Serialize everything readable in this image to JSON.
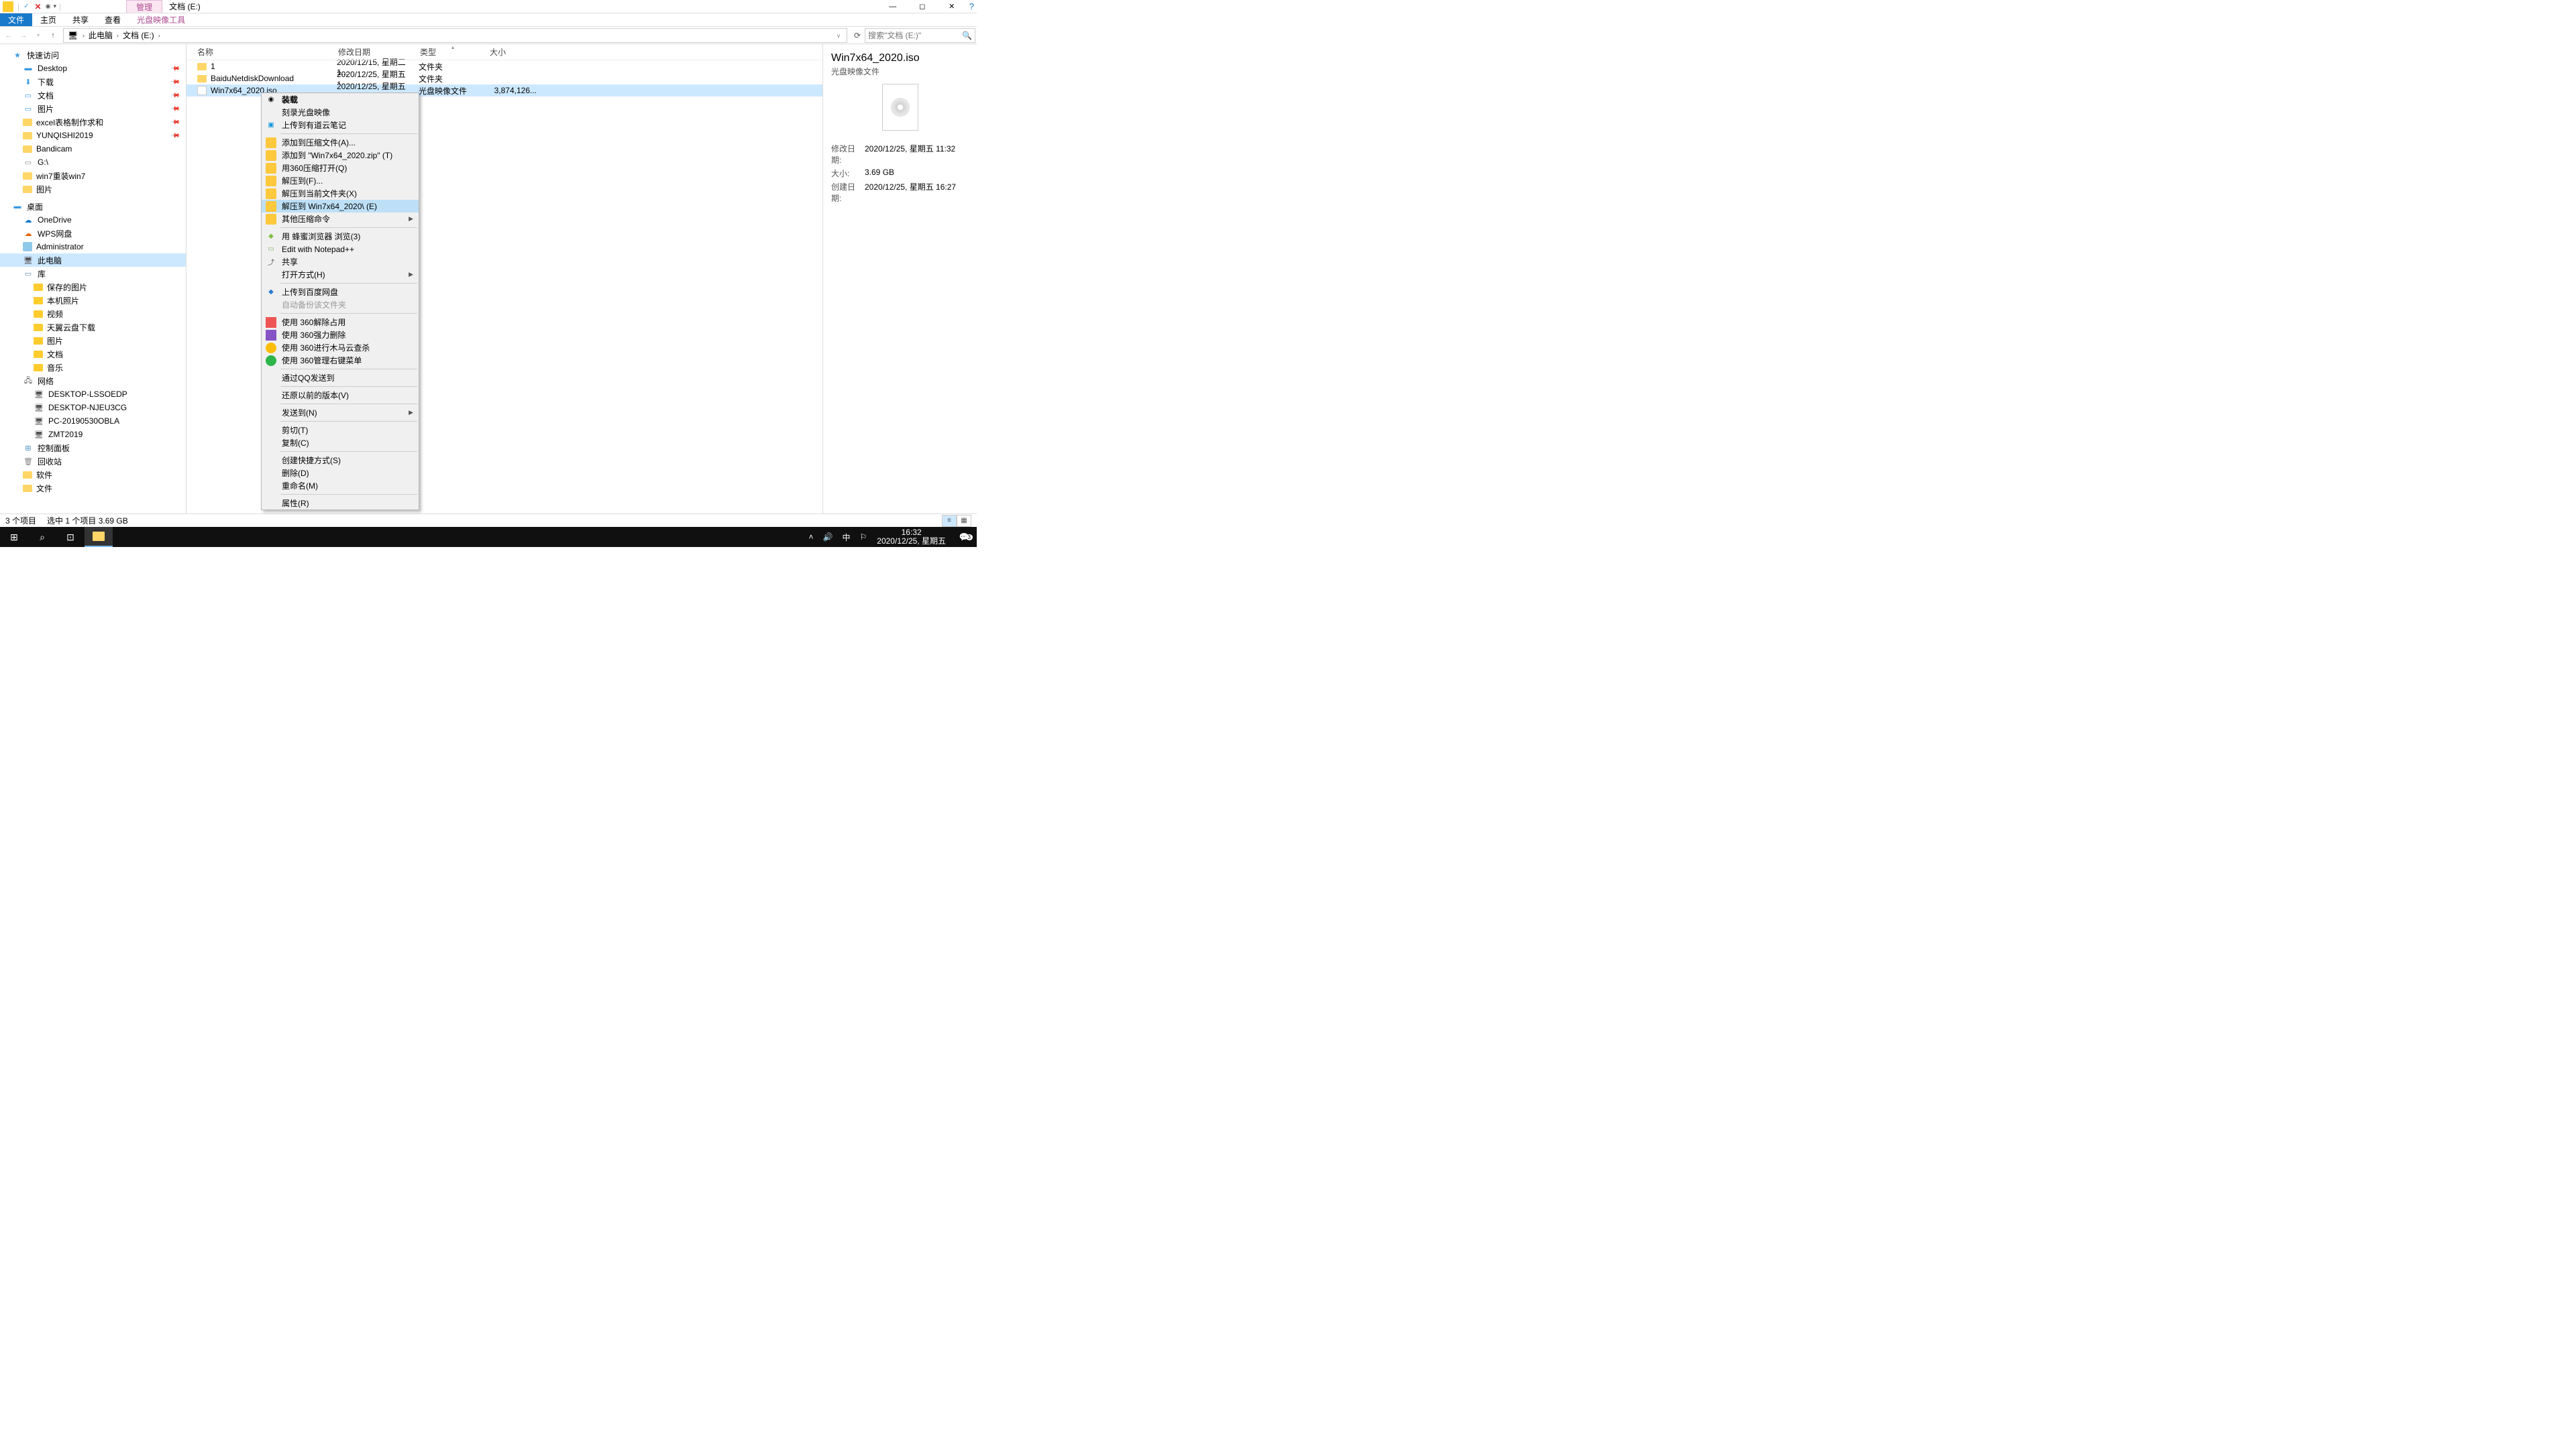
{
  "title": {
    "manage_tab": "管理",
    "window_title": "文档 (E:)"
  },
  "ribbon": {
    "file": "文件",
    "home": "主页",
    "share": "共享",
    "view": "查看",
    "disc_tools": "光盘映像工具"
  },
  "address": {
    "root": "此电脑",
    "folder": "文档 (E:)"
  },
  "search": {
    "placeholder": "搜索\"文档 (E:)\""
  },
  "nav": {
    "quick_access": "快速访问",
    "desktop": "Desktop",
    "downloads": "下载",
    "documents": "文档",
    "pictures": "图片",
    "excel": "excel表格制作求和",
    "yunqishi": "YUNQISHI2019",
    "bandicam": "Bandicam",
    "gdrive": "G:\\",
    "win7": "win7重装win7",
    "pics2": "图片",
    "desktop2": "桌面",
    "onedrive": "OneDrive",
    "wps": "WPS网盘",
    "admin": "Administrator",
    "this_pc": "此电脑",
    "libraries": "库",
    "saved_pics": "保存的图片",
    "local_photos": "本机照片",
    "videos": "视频",
    "tianyidl": "天翼云盘下载",
    "pics3": "图片",
    "docs2": "文档",
    "music": "音乐",
    "network": "网络",
    "pc1": "DESKTOP-LSSOEDP",
    "pc2": "DESKTOP-NJEU3CG",
    "pc3": "PC-20190530OBLA",
    "pc4": "ZMT2019",
    "ctrl_panel": "控制面板",
    "recycle": "回收站",
    "software": "软件",
    "files": "文件"
  },
  "columns": {
    "name": "名称",
    "date": "修改日期",
    "type": "类型",
    "size": "大小"
  },
  "rows": [
    {
      "name": "1",
      "date": "2020/12/15, 星期二 1...",
      "type": "文件夹",
      "size": ""
    },
    {
      "name": "BaiduNetdiskDownload",
      "date": "2020/12/25, 星期五 1...",
      "type": "文件夹",
      "size": ""
    },
    {
      "name": "Win7x64_2020.iso",
      "date": "2020/12/25, 星期五 1...",
      "type": "光盘映像文件",
      "size": "3,874,126..."
    }
  ],
  "ctx": {
    "mount": "装载",
    "burn": "刻录光盘映像",
    "youdao": "上传到有道云笔记",
    "add_archive": "添加到压缩文件(A)...",
    "add_zip": "添加到 \"Win7x64_2020.zip\" (T)",
    "open_360": "用360压缩打开(Q)",
    "extract_to": "解压到(F)...",
    "extract_here": "解压到当前文件夹(X)",
    "extract_named": "解压到 Win7x64_2020\\ (E)",
    "other_archive": "其他压缩命令",
    "bee": "用 蜂蜜浏览器 浏览(3)",
    "npp": "Edit with Notepad++",
    "share": "共享",
    "open_with": "打开方式(H)",
    "baidu_up": "上传到百度网盘",
    "auto_backup": "自动备份该文件夹",
    "360_unlock": "使用 360解除占用",
    "360_force_del": "使用 360强力删除",
    "360_trojan": "使用 360进行木马云查杀",
    "360_menu": "使用 360管理右键菜单",
    "qq_send": "通过QQ发送到",
    "restore_prev": "还原以前的版本(V)",
    "send_to": "发送到(N)",
    "cut": "剪切(T)",
    "copy": "复制(C)",
    "shortcut": "创建快捷方式(S)",
    "delete": "删除(D)",
    "rename": "重命名(M)",
    "props": "属性(R)"
  },
  "details": {
    "filename": "Win7x64_2020.iso",
    "filetype": "光盘映像文件",
    "mdate_lbl": "修改日期:",
    "mdate": "2020/12/25, 星期五 11:32",
    "size_lbl": "大小:",
    "size": "3.69 GB",
    "cdate_lbl": "创建日期:",
    "cdate": "2020/12/25, 星期五 16:27"
  },
  "status": {
    "count": "3 个项目",
    "selected": "选中 1 个项目  3.69 GB"
  },
  "taskbar": {
    "ime": "中",
    "time": "16:32",
    "date": "2020/12/25, 星期五",
    "notif_badge": "3"
  }
}
